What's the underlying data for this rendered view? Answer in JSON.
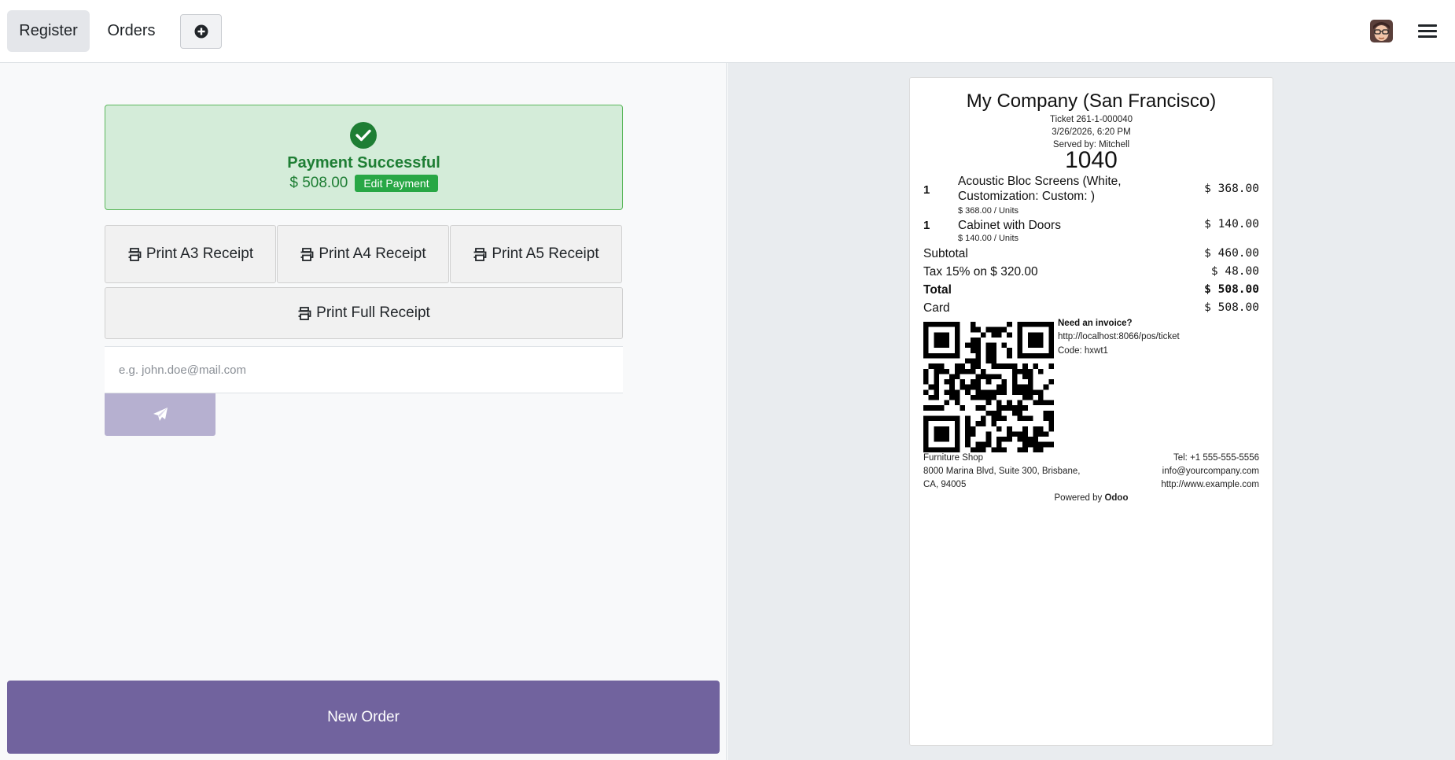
{
  "navbar": {
    "register_label": "Register",
    "orders_label": "Orders",
    "add_icon": "plus-circle-icon",
    "menu_icon": "hamburger-menu-icon"
  },
  "payment": {
    "status_icon": "check-circle-icon",
    "title": "Payment Successful",
    "amount": "$ 508.00",
    "edit_label": "Edit Payment"
  },
  "print_buttons": {
    "icon": "printer-icon",
    "a3": "Print A3 Receipt",
    "a4": "Print A4 Receipt",
    "a5": "Print A5 Receipt",
    "full": "Print Full Receipt"
  },
  "email": {
    "placeholder": "e.g. john.doe@mail.com",
    "value": "",
    "send_icon": "paper-plane-icon"
  },
  "new_order_label": "New Order",
  "receipt": {
    "company": "My Company (San Francisco)",
    "ticket": "Ticket 261-1-000040",
    "datetime": "3/26/2026, 6:20 PM",
    "served_by": "Served by: Mitchell",
    "tracking_number": "1040",
    "lines": [
      {
        "qty": "1",
        "name": "Acoustic Bloc Screens (White, Customization: Custom: )",
        "unit": "$ 368.00 / Units",
        "price": "$ 368.00"
      },
      {
        "qty": "1",
        "name": "Cabinet with Doors",
        "unit": "$ 140.00 / Units",
        "price": "$ 140.00"
      }
    ],
    "subtotal_label": "Subtotal",
    "subtotal": "$ 460.00",
    "tax_label": "Tax 15% on $ 320.00",
    "tax": "$ 48.00",
    "total_label": "Total",
    "total": "$ 508.00",
    "payment_method": "Card",
    "payment_amount": "$ 508.00",
    "invoice_title": "Need an invoice?",
    "invoice_url": "http://localhost:8066/pos/ticket",
    "invoice_code": "Code: hxwt1",
    "shop_name": "Furniture Shop",
    "address_line1": "8000 Marina Blvd, Suite 300, Brisbane,",
    "address_line2": "CA, 94005",
    "phone": "Tel: +1 555-555-5556",
    "email": "info@yourcompany.com",
    "website": "http://www.example.com",
    "powered_prefix": "Powered by",
    "powered_brand": "Odoo"
  },
  "colors": {
    "accent": "#71639e",
    "success": "#1e7e34",
    "success_bg": "#d4ecd9",
    "edit_button": "#28a745"
  }
}
